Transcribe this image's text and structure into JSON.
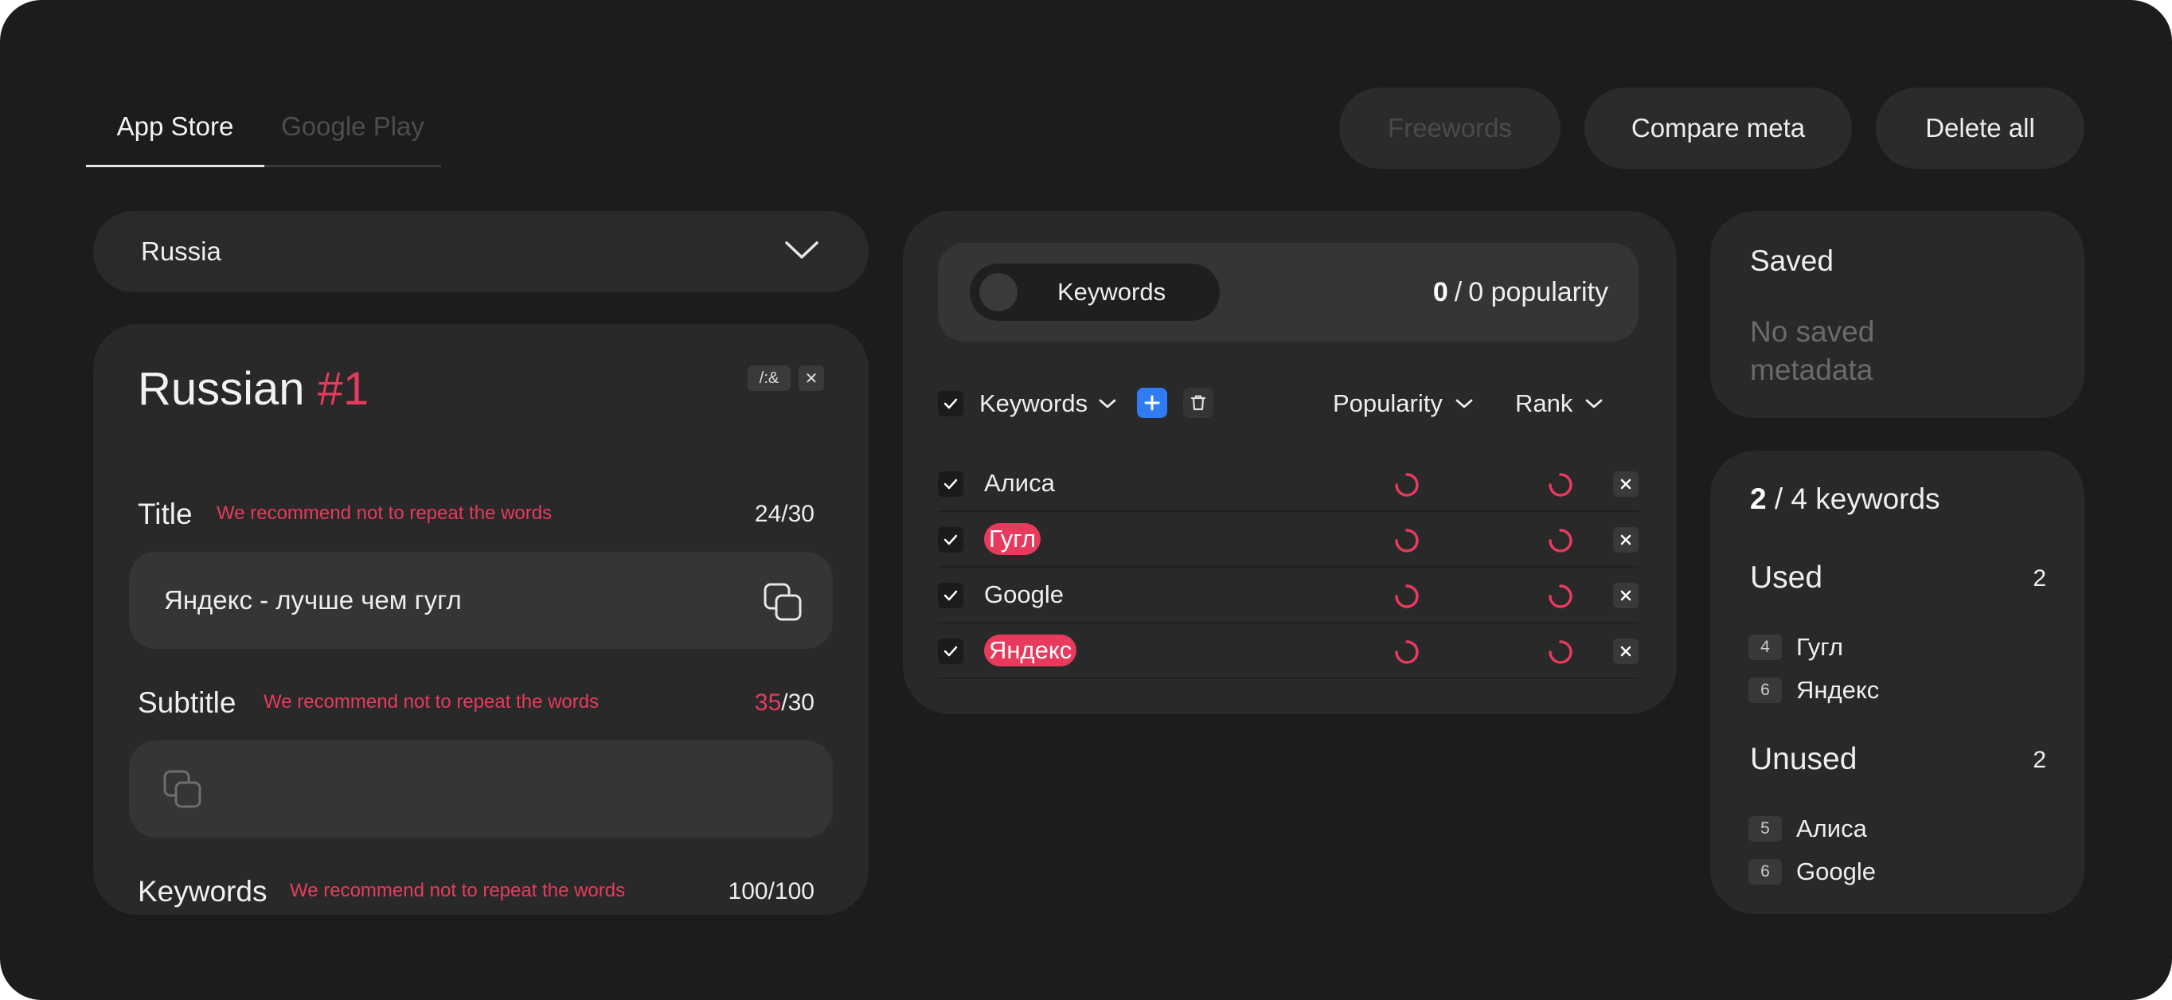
{
  "tabs": [
    {
      "label": "App Store",
      "active": true
    },
    {
      "label": "Google Play",
      "active": false
    }
  ],
  "toolbar": {
    "freewords_label": "Freewords",
    "compare_label": "Compare meta",
    "delete_all_label": "Delete all"
  },
  "country": {
    "selected": "Russia"
  },
  "locale_card": {
    "language": "Russian",
    "number": "#1",
    "symbols_tag": "/:&",
    "close_tag": "✕",
    "title": {
      "label": "Title",
      "warning": "We recommend not to repeat the words",
      "count_used": "24",
      "count_max": "/30",
      "value": "Яндекс - лучше чем гугл"
    },
    "subtitle": {
      "label": "Subtitle",
      "warning": "We recommend not to repeat the words",
      "count_used": "35",
      "count_max": "/30",
      "value": ""
    },
    "keywords": {
      "label": "Keywords",
      "warning": "We recommend not to repeat the words",
      "count": "100/100"
    }
  },
  "keywords_panel": {
    "toggle_label": "Keywords",
    "popularity_current": "0",
    "popularity_sep": "/",
    "popularity_total": "0 popularity",
    "header": {
      "keywords": "Keywords",
      "popularity": "Popularity",
      "rank": "Rank"
    },
    "rows": [
      {
        "keyword": "Алиса",
        "highlighted": false
      },
      {
        "keyword": "Гугл",
        "highlighted": true
      },
      {
        "keyword": "Google",
        "highlighted": false
      },
      {
        "keyword": "Яндекс",
        "highlighted": true
      }
    ]
  },
  "saved": {
    "title": "Saved",
    "empty_text": "No saved metadata"
  },
  "keyword_stats": {
    "used_count": "2",
    "total_text": "/ 4 keywords",
    "used": {
      "title": "Used",
      "count": "2",
      "items": [
        {
          "badge": "4",
          "word": "Гугл"
        },
        {
          "badge": "6",
          "word": "Яндекс"
        }
      ]
    },
    "unused": {
      "title": "Unused",
      "count": "2",
      "items": [
        {
          "badge": "5",
          "word": "Алиса"
        },
        {
          "badge": "6",
          "word": "Google"
        }
      ]
    }
  },
  "colors": {
    "background": "#1c1c1c",
    "card": "#292929",
    "accent_red": "#e83a5c",
    "accent_blue": "#2f7cf6"
  },
  "icons": {
    "chevron": "chevron-down-icon",
    "copy": "copy-icon",
    "check": "check-icon",
    "plus": "plus-icon",
    "trash": "trash-icon",
    "spinner": "loading-spinner-icon",
    "close": "close-icon"
  }
}
